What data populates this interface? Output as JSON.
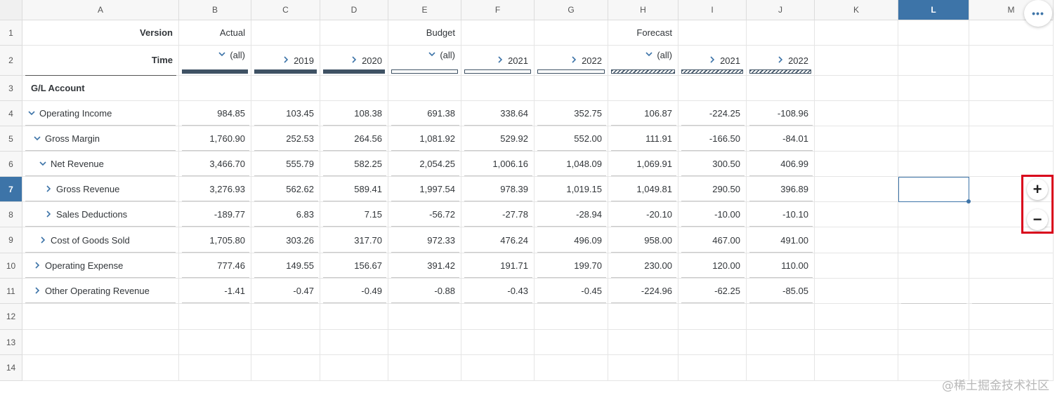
{
  "columns": [
    "A",
    "B",
    "C",
    "D",
    "E",
    "F",
    "G",
    "H",
    "I",
    "J",
    "K",
    "L",
    "M"
  ],
  "selected_column": "L",
  "rows": [
    "1",
    "2",
    "3",
    "4",
    "5",
    "6",
    "7",
    "8",
    "9",
    "10",
    "11",
    "12",
    "13",
    "14"
  ],
  "selected_row": "7",
  "header": {
    "version_label": "Version",
    "time_label": "Time",
    "gl_account_label": "G/L Account",
    "versions": {
      "B": "Actual",
      "E": "Budget",
      "H": "Forecast"
    },
    "time": {
      "B": "(all)",
      "C": "2019",
      "D": "2020",
      "E": "(all)",
      "F": "2021",
      "G": "2022",
      "H": "(all)",
      "I": "2021",
      "J": "2022"
    }
  },
  "accounts": [
    {
      "label": "Operating Income",
      "expand": "down",
      "values": [
        "984.85",
        "103.45",
        "108.38",
        "691.38",
        "338.64",
        "352.75",
        "106.87",
        "-224.25",
        "-108.96"
      ]
    },
    {
      "label": "Gross Margin",
      "expand": "down",
      "values": [
        "1,760.90",
        "252.53",
        "264.56",
        "1,081.92",
        "529.92",
        "552.00",
        "111.91",
        "-166.50",
        "-84.01"
      ]
    },
    {
      "label": "Net Revenue",
      "expand": "down",
      "values": [
        "3,466.70",
        "555.79",
        "582.25",
        "2,054.25",
        "1,006.16",
        "1,048.09",
        "1,069.91",
        "300.50",
        "406.99"
      ]
    },
    {
      "label": "Gross Revenue",
      "expand": "right",
      "values": [
        "3,276.93",
        "562.62",
        "589.41",
        "1,997.54",
        "978.39",
        "1,019.15",
        "1,049.81",
        "290.50",
        "396.89"
      ]
    },
    {
      "label": "Sales Deductions",
      "expand": "right",
      "values": [
        "-189.77",
        "6.83",
        "7.15",
        "-56.72",
        "-27.78",
        "-28.94",
        "-20.10",
        "-10.00",
        "-10.10"
      ]
    },
    {
      "label": "Cost of Goods Sold",
      "expand": "right",
      "values": [
        "1,705.80",
        "303.26",
        "317.70",
        "972.33",
        "476.24",
        "496.09",
        "958.00",
        "467.00",
        "491.00"
      ]
    },
    {
      "label": "Operating Expense",
      "expand": "right",
      "values": [
        "777.46",
        "149.55",
        "156.67",
        "391.42",
        "191.71",
        "199.70",
        "230.00",
        "120.00",
        "110.00"
      ]
    },
    {
      "label": "Other Operating Revenue",
      "expand": "right",
      "values": [
        "-1.41",
        "-0.47",
        "-0.49",
        "-0.88",
        "-0.43",
        "-0.45",
        "-224.96",
        "-62.25",
        "-85.05"
      ]
    }
  ],
  "toolbar": {
    "more_icon": "more-horizontal-icon",
    "more_label": "•••",
    "zoom_in_icon": "plus-icon",
    "zoom_in_label": "+",
    "zoom_out_icon": "minus-icon",
    "zoom_out_label": "−"
  },
  "watermark": "@稀土掘金技术社区",
  "colors": {
    "selection": "#3d74a8",
    "highlight_box": "#d9001b",
    "bar_fill": "#3f5264"
  }
}
